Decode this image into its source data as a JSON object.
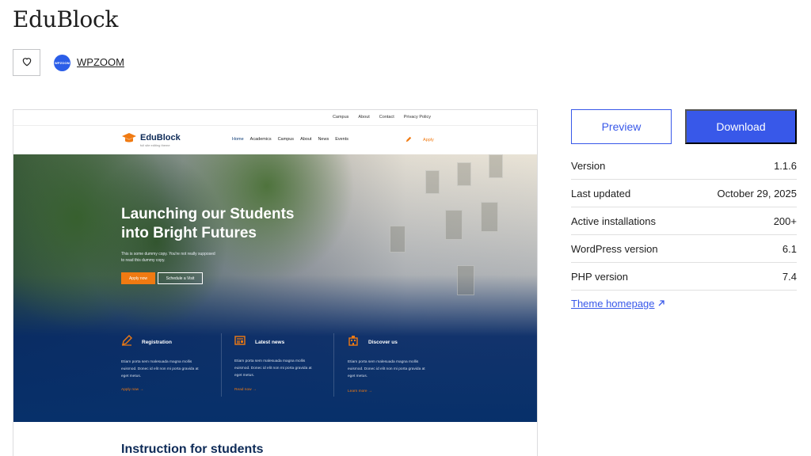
{
  "theme": {
    "title": "EduBlock"
  },
  "author": {
    "logo_text": "WPZOOM",
    "name": "WPZOOM"
  },
  "preview_site": {
    "top_nav": [
      "Campus",
      "About",
      "Contact",
      "Privacy Policy"
    ],
    "logo_name": "EduBlock",
    "logo_tagline": "full site editing theme",
    "main_nav": [
      "Home",
      "Academics",
      "Campus",
      "About",
      "News",
      "Events"
    ],
    "apply_label": "Apply",
    "hero_title_line1": "Launching our Students",
    "hero_title_line2": "into Bright Futures",
    "hero_copy": "This is some dummy copy. You're not really supposed to read this dummy copy.",
    "apply_now": "Apply now",
    "schedule_visit": "Schedule a Visit",
    "features": [
      {
        "title": "Registration",
        "text": "Etiam porta sem malesuada magna mollis euismod. Donec id elit non mi porta gravida at eget metus.",
        "link": "Apply now →"
      },
      {
        "title": "Latest news",
        "text": "Etiam porta sem malesuada magna mollis euismod. Donec id elit non mi porta gravida at eget metus.",
        "link": "Read now →"
      },
      {
        "title": "Discover us",
        "text": "Etiam porta sem malesuada magna mollis euismod. Donec id elit non mi porta gravida at eget metus.",
        "link": "Learn more →"
      }
    ],
    "instructions_heading": "Instruction for students"
  },
  "actions": {
    "preview": "Preview",
    "download": "Download"
  },
  "meta": [
    {
      "label": "Version",
      "value": "1.1.6"
    },
    {
      "label": "Last updated",
      "value": "October 29, 2025"
    },
    {
      "label": "Active installations",
      "value": "200+"
    },
    {
      "label": "WordPress version",
      "value": "6.1"
    },
    {
      "label": "PHP version",
      "value": "7.4"
    }
  ],
  "theme_homepage": "Theme homepage",
  "colors": {
    "accent": "#3858e9",
    "orange": "#f07a12",
    "navy": "#0d2a57"
  }
}
